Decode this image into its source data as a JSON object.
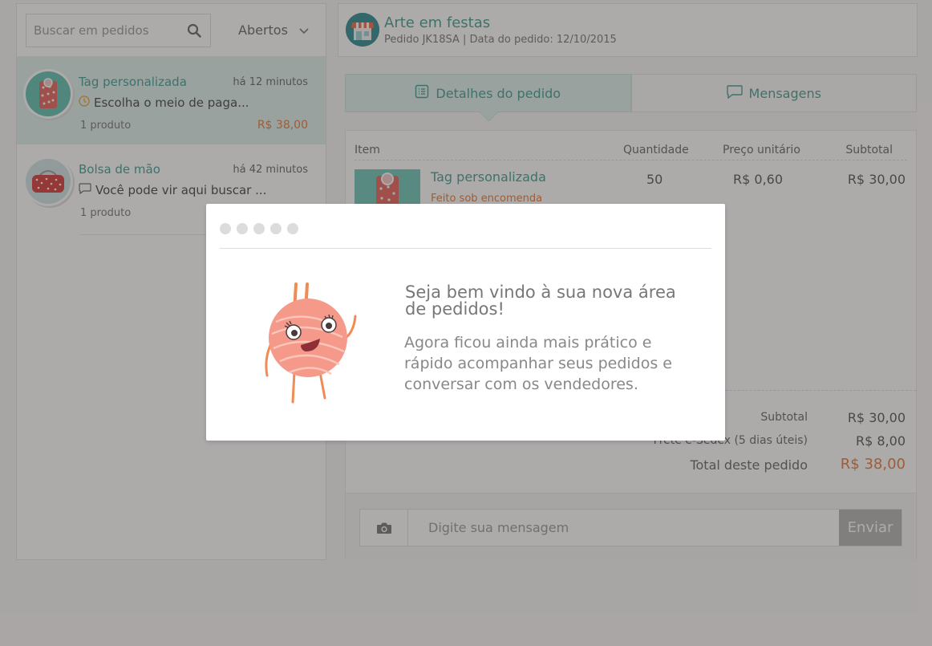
{
  "sidebar": {
    "search_placeholder": "Buscar em pedidos",
    "filter_label": "Abertos",
    "conversations": [
      {
        "title": "Tag personalizada",
        "time": "há 12 minutos",
        "message": "Escolha o meio de paga...",
        "status_icon": "clock-icon",
        "count": "1 produto",
        "price": "R$ 38,00"
      },
      {
        "title": "Bolsa de mão",
        "time": "há 42 minutos",
        "message": "Você pode vir aqui buscar ...",
        "status_icon": "chat-bubble-icon",
        "count": "1 produto"
      }
    ]
  },
  "order": {
    "shop_name": "Arte em festas",
    "subtitle": "Pedido JK18SA | Data do pedido: 12/10/2015",
    "tabs": [
      {
        "label": "Detalhes do pedido",
        "icon": "list-icon"
      },
      {
        "label": "Mensagens",
        "icon": "chat-bubble-icon"
      }
    ],
    "table": {
      "headers": {
        "item": "Item",
        "qty": "Quantidade",
        "unit": "Preço unitário",
        "subtotal": "Subtotal"
      },
      "rows": [
        {
          "title": "Tag personalizada",
          "note": "Feito sob encomenda",
          "qty": "50",
          "unit": "R$ 0,60",
          "subtotal": "R$ 30,00"
        }
      ]
    },
    "totals": {
      "subtotal_label": "Subtotal",
      "subtotal_value": "R$ 30,00",
      "shipping_label": "Frete e-Sedex (5 dias úteis)",
      "shipping_value": "R$ 8,00",
      "total_label": "Total deste pedido",
      "total_value": "R$ 38,00"
    },
    "message_placeholder": "Digite sua mensagem",
    "send_label": "Enviar"
  },
  "modal": {
    "title": "Seja bem vindo à sua nova área de pedidos!",
    "body": "Agora ficou ainda mais prático e rápido acompanhar seus pedidos e conversar com os vendedores."
  },
  "colors": {
    "teal": "#3f9e93",
    "orange": "#e2793a",
    "active_bg": "#dff0ee",
    "overlay": "rgba(60,55,52,0.42)"
  }
}
